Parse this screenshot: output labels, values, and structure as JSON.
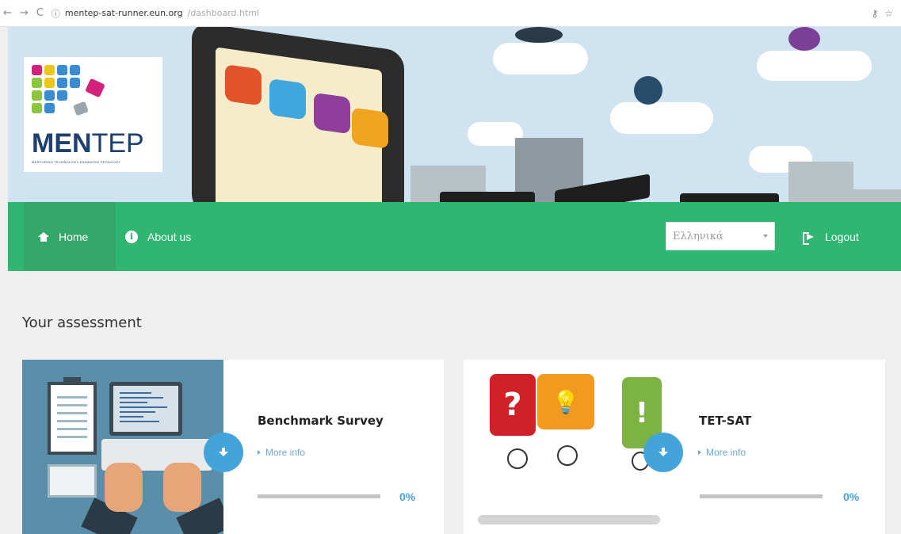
{
  "browser": {
    "url_host": "mentep-sat-runner.eun.org",
    "url_path": "/dashboard.html"
  },
  "logo": {
    "bold": "MEN",
    "thin": "TEP",
    "tagline": "MENTORING TECHNOLOGY-ENHANCED PEDAGOGY"
  },
  "nav": {
    "home": "Home",
    "about": "About us",
    "language": "Ελληνικά",
    "logout": "Logout"
  },
  "section_title": "Your assessment",
  "cards": [
    {
      "title": "Benchmark Survey",
      "more_info": "More info",
      "progress_percent": 0,
      "percent_label": "0%"
    },
    {
      "title": "TET-SAT",
      "more_info": "More info",
      "progress_percent": 0,
      "percent_label": "0%"
    }
  ],
  "illustration_text": {
    "q_mark": "?",
    "bulb": "💡",
    "excl": "!"
  },
  "colors": {
    "nav_green": "#2fb671",
    "accent_blue": "#43a4dc",
    "logo_navy": "#1d4070"
  }
}
